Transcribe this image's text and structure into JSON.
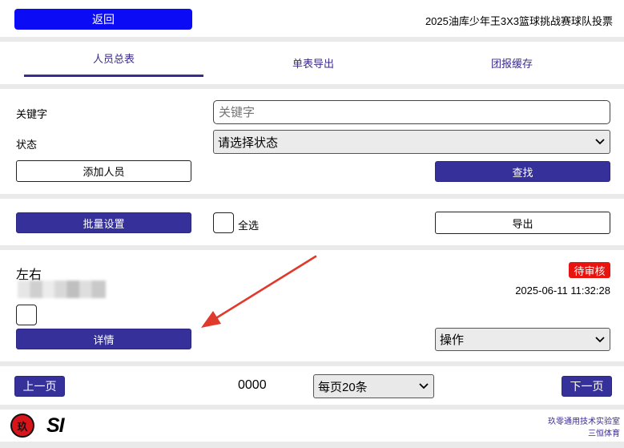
{
  "header": {
    "back_label": "返回",
    "title": "2025油库少年王3X3篮球挑战赛球队投票"
  },
  "tabs": [
    {
      "label": "人员总表",
      "active": true
    },
    {
      "label": "单表导出",
      "active": false
    },
    {
      "label": "团报缓存",
      "active": false
    }
  ],
  "filters": {
    "keyword_label": "关键字",
    "keyword_placeholder": "关键字",
    "status_label": "状态",
    "status_selected": "请选择状态",
    "add_label": "添加人员",
    "search_label": "查找"
  },
  "batch": {
    "batch_label": "批量设置",
    "select_all_label": "全选",
    "export_label": "导出"
  },
  "record": {
    "name": "左右",
    "status_badge": "待审核",
    "timestamp": "2025-06-11 11:32:28",
    "detail_label": "详情",
    "action_selected": "操作"
  },
  "pagination": {
    "prev_label": "上一页",
    "page_number": "0000",
    "per_page_selected": "每页20条",
    "next_label": "下一页"
  },
  "footer": {
    "lab_name": "玖零通用技术实验室",
    "partner_name": "三恒体育",
    "logo_char": "玖",
    "brand_text": "SI"
  },
  "colors": {
    "primary": "#36319a",
    "header_button": "#0b0bf5",
    "badge": "#e8140f",
    "arrow": "#e03a2c",
    "tab_underline": "#3b2a8f"
  }
}
